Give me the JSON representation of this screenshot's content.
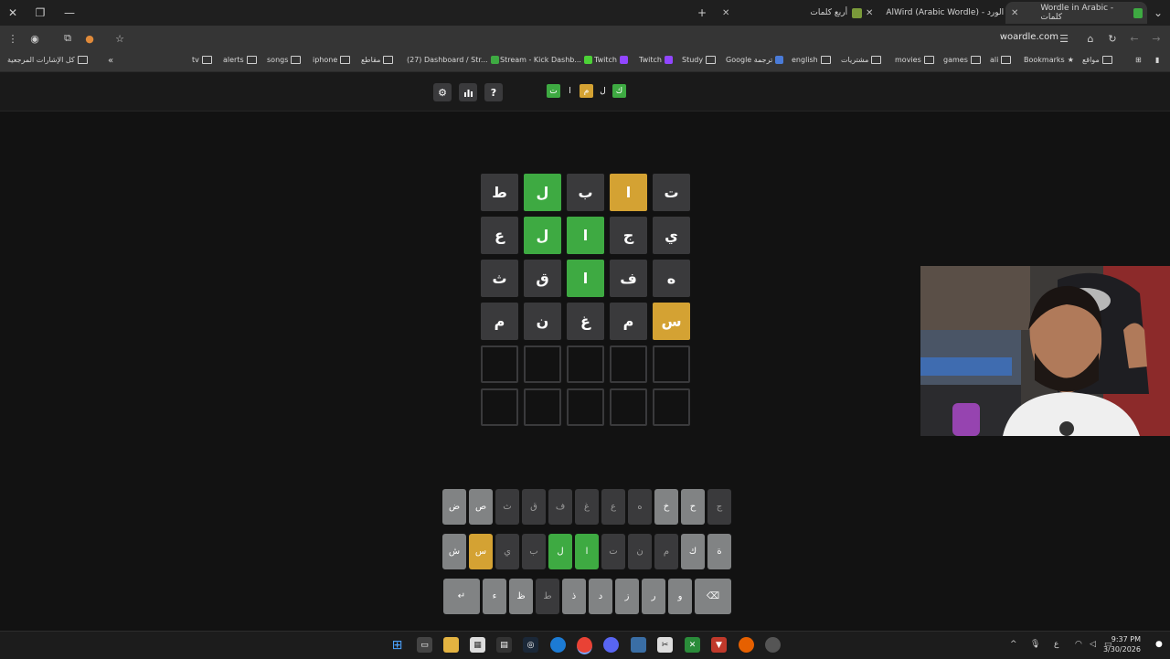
{
  "browser": {
    "tabs": [
      {
        "title": "Wordle in Arabic - كلمات",
        "active": true,
        "favicon_color": "#3eaa42"
      },
      {
        "title": "AlWird (Arabic Wordle) - الورد",
        "active": false,
        "favicon_color": "#3eaa42"
      },
      {
        "title": "أربع كلمات",
        "active": false,
        "favicon_color": "#7a9a3a"
      }
    ],
    "url": "woardle.com",
    "bookmarks": [
      {
        "label": "مواقع",
        "type": "folder"
      },
      {
        "label": "Bookmarks",
        "type": "star"
      },
      {
        "label": "ali",
        "type": "folder"
      },
      {
        "label": "games",
        "type": "folder"
      },
      {
        "label": "movies",
        "type": "folder"
      },
      {
        "label": "مشتريات",
        "type": "folder"
      },
      {
        "label": "english",
        "type": "folder"
      },
      {
        "label": "Google ترجمة",
        "type": "site"
      },
      {
        "label": "Study",
        "type": "folder"
      },
      {
        "label": "Twitch",
        "type": "site"
      },
      {
        "label": "Twitch",
        "type": "site"
      },
      {
        "label": "Stream - Kick Dashb...",
        "type": "site"
      },
      {
        "label": "(27) Dashboard / Str...",
        "type": "site"
      },
      {
        "label": "مقاطع",
        "type": "folder"
      },
      {
        "label": "iphone",
        "type": "folder"
      },
      {
        "label": "songs",
        "type": "folder"
      },
      {
        "label": "alerts",
        "type": "folder"
      },
      {
        "label": "tv",
        "type": "folder"
      }
    ],
    "all_bookmarks": "كل الإشارات المرجعية",
    "overflow": "«"
  },
  "app": {
    "logo_letters": [
      {
        "ch": "ك",
        "state": "correct"
      },
      {
        "ch": "ل",
        "state": "plain"
      },
      {
        "ch": "م",
        "state": "present"
      },
      {
        "ch": "ا",
        "state": "plain"
      },
      {
        "ch": "ت",
        "state": "correct"
      }
    ],
    "icons": [
      "help-icon",
      "stats-icon",
      "settings-icon"
    ],
    "help_glyph": "?"
  },
  "board": [
    [
      {
        "ch": "ت",
        "s": "absent"
      },
      {
        "ch": "ا",
        "s": "present"
      },
      {
        "ch": "ب",
        "s": "absent"
      },
      {
        "ch": "ل",
        "s": "correct"
      },
      {
        "ch": "ط",
        "s": "absent"
      }
    ],
    [
      {
        "ch": "ي",
        "s": "absent"
      },
      {
        "ch": "ج",
        "s": "absent"
      },
      {
        "ch": "ا",
        "s": "correct"
      },
      {
        "ch": "ل",
        "s": "correct"
      },
      {
        "ch": "ع",
        "s": "absent"
      }
    ],
    [
      {
        "ch": "ه",
        "s": "absent"
      },
      {
        "ch": "ف",
        "s": "absent"
      },
      {
        "ch": "ا",
        "s": "correct"
      },
      {
        "ch": "ق",
        "s": "absent"
      },
      {
        "ch": "ث",
        "s": "absent"
      }
    ],
    [
      {
        "ch": "س",
        "s": "present"
      },
      {
        "ch": "م",
        "s": "absent"
      },
      {
        "ch": "غ",
        "s": "absent"
      },
      {
        "ch": "ن",
        "s": "absent"
      },
      {
        "ch": "م",
        "s": "absent"
      }
    ],
    [
      {
        "ch": "",
        "s": "empty"
      },
      {
        "ch": "",
        "s": "empty"
      },
      {
        "ch": "",
        "s": "empty"
      },
      {
        "ch": "",
        "s": "empty"
      },
      {
        "ch": "",
        "s": "empty"
      }
    ],
    [
      {
        "ch": "",
        "s": "empty"
      },
      {
        "ch": "",
        "s": "empty"
      },
      {
        "ch": "",
        "s": "empty"
      },
      {
        "ch": "",
        "s": "empty"
      },
      {
        "ch": "",
        "s": "empty"
      }
    ]
  ],
  "keyboard": [
    [
      {
        "ch": "ج",
        "s": "absent"
      },
      {
        "ch": "ح",
        "s": "unused"
      },
      {
        "ch": "خ",
        "s": "unused"
      },
      {
        "ch": "ه",
        "s": "absent"
      },
      {
        "ch": "ع",
        "s": "absent"
      },
      {
        "ch": "غ",
        "s": "absent"
      },
      {
        "ch": "ف",
        "s": "absent"
      },
      {
        "ch": "ق",
        "s": "absent"
      },
      {
        "ch": "ث",
        "s": "absent"
      },
      {
        "ch": "ص",
        "s": "unused"
      },
      {
        "ch": "ض",
        "s": "unused"
      }
    ],
    [
      {
        "ch": "ة",
        "s": "unused"
      },
      {
        "ch": "ك",
        "s": "unused"
      },
      {
        "ch": "م",
        "s": "absent"
      },
      {
        "ch": "ن",
        "s": "absent"
      },
      {
        "ch": "ت",
        "s": "absent"
      },
      {
        "ch": "ا",
        "s": "correct"
      },
      {
        "ch": "ل",
        "s": "correct"
      },
      {
        "ch": "ب",
        "s": "absent"
      },
      {
        "ch": "ي",
        "s": "absent"
      },
      {
        "ch": "س",
        "s": "present"
      },
      {
        "ch": "ش",
        "s": "unused"
      }
    ],
    [
      {
        "ch": "⌫",
        "s": "unused",
        "wide": true
      },
      {
        "ch": "و",
        "s": "unused"
      },
      {
        "ch": "ر",
        "s": "unused"
      },
      {
        "ch": "ز",
        "s": "unused"
      },
      {
        "ch": "د",
        "s": "unused"
      },
      {
        "ch": "ذ",
        "s": "unused"
      },
      {
        "ch": "ط",
        "s": "absent"
      },
      {
        "ch": "ظ",
        "s": "unused"
      },
      {
        "ch": "ء",
        "s": "unused"
      },
      {
        "ch": "↵",
        "s": "unused",
        "wide": true
      }
    ]
  ],
  "taskbar": {
    "time": "9:37 PM",
    "date": "3/30/2026",
    "lang": "ع"
  },
  "colors": {
    "correct": "#3eaa42",
    "present": "#d4a233",
    "absent": "#3a3a3c",
    "unused": "#818384"
  }
}
